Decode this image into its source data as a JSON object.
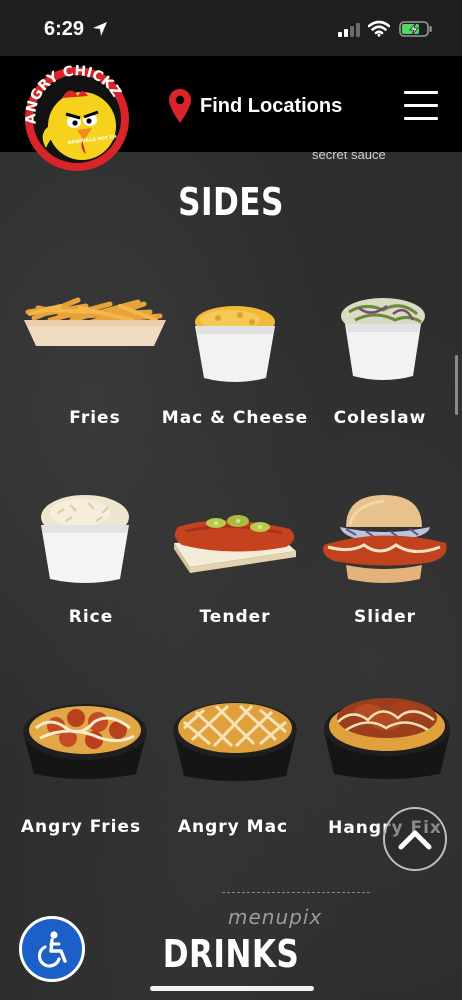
{
  "status": {
    "time": "6:29"
  },
  "header": {
    "logo_text": "ANGRY CHICKZ",
    "logo_subtext": "NASHVILLE HOT CHICKEN",
    "find_locations": "Find Locations"
  },
  "content": {
    "partial_text": "secret sauce",
    "sides_title": "SIDES",
    "items": [
      {
        "label": "Fries"
      },
      {
        "label": "Mac & Cheese"
      },
      {
        "label": "Coleslaw"
      },
      {
        "label": "Rice"
      },
      {
        "label": "Tender"
      },
      {
        "label": "Slider"
      },
      {
        "label": "Angry Fries"
      },
      {
        "label": "Angry Mac"
      },
      {
        "label": "Hangry Fix"
      }
    ],
    "drinks_title": "DRINKS"
  },
  "watermark": "menupix",
  "colors": {
    "accent_red": "#d9252a",
    "logo_yellow": "#f7d21c",
    "accessibility_blue": "#1c5fc6",
    "background": "#2e2e2e"
  }
}
